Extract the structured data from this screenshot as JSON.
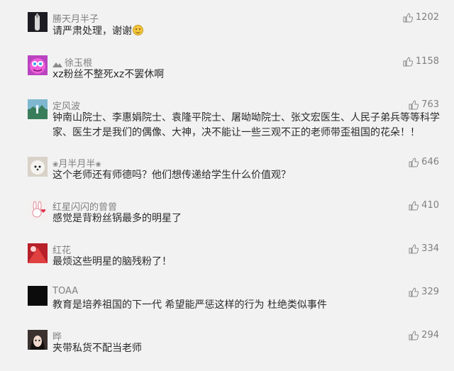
{
  "comments": [
    {
      "username": "勝天月半子",
      "text": "请严肃处理，谢谢",
      "emoji": "smile-emoji",
      "likes": "1202",
      "avatar_color": "#1b1b22"
    },
    {
      "username": "徐玉根",
      "text": "xz粉丝不整死xz不罢休啊",
      "likes": "1158",
      "avatar_color": "#d44bd8"
    },
    {
      "username": "定风波",
      "text": "钟南山院士、李惠娟院士、袁隆平院士、屠呦呦院士、张文宏医生、人民子弟兵等等科学家、医生才是我们的偶像、大神，决不能让一些三观不正的老师带歪祖国的花朵！！",
      "likes": "763",
      "avatar_color": "#3f8fb0"
    },
    {
      "username": "月半月半",
      "text": "这个老师还有师德吗？他们想传递给学生什么价值观？",
      "likes": "646",
      "avatar_color": "#ece7e0"
    },
    {
      "username": "红星闪闪的曾曾",
      "text": "感觉是背粉丝锅最多的明星了",
      "likes": "410",
      "avatar_color": "#f7f2f2"
    },
    {
      "username": "红花",
      "text": "最烦这些明星的脑残粉了！",
      "likes": "334",
      "avatar_color": "#c0262a"
    },
    {
      "username": "TOAA",
      "text": "教育是培养祖国的下一代 希望能严惩这样的行为 杜绝类似事件",
      "likes": "329",
      "avatar_color": "#0c0c0c"
    },
    {
      "username": "晔",
      "text": "夹带私货不配当老师",
      "likes": "294",
      "avatar_color": "#4a3d3a"
    }
  ]
}
